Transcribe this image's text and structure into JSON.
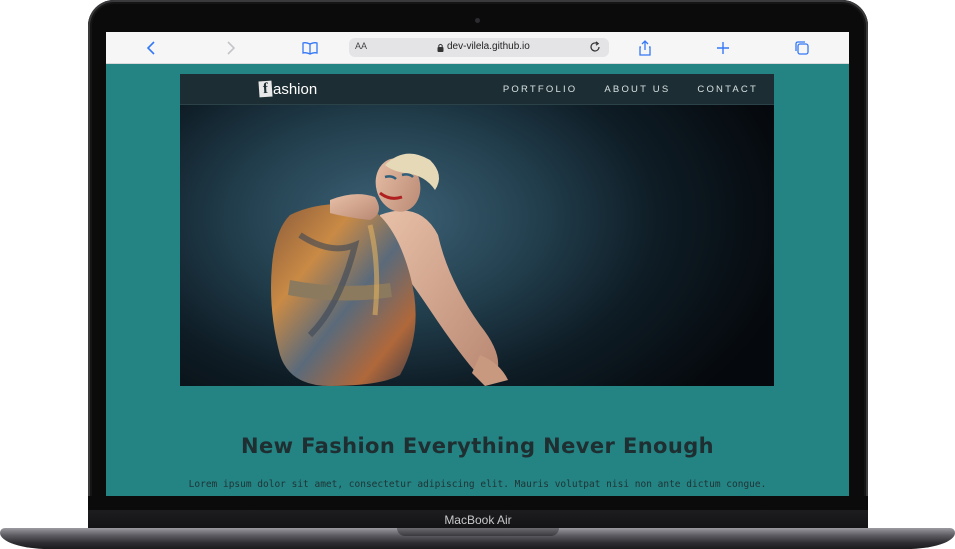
{
  "device": {
    "model_label": "MacBook Air"
  },
  "browser": {
    "url": "dev-vilela.github.io",
    "text_size_label": "AA",
    "icons": [
      "chevron-left-icon",
      "chevron-right-icon",
      "book-icon",
      "lock-icon",
      "reload-icon",
      "share-icon",
      "plus-icon",
      "tabs-icon"
    ]
  },
  "site": {
    "logo_letter": "f",
    "logo_text": "ashion",
    "nav": {
      "items": [
        {
          "label": "PORTFOLIO"
        },
        {
          "label": "ABOUT US"
        },
        {
          "label": "CONTACT"
        }
      ]
    },
    "headline": "New Fashion Everything Never Enough",
    "body_text": "Lorem ipsum dolor sit amet, consectetur adipiscing elit. Mauris volutpat nisi non ante dictum congue."
  },
  "colors": {
    "page_teal": "#248383",
    "nav_bg": "#1c2e33",
    "browser_accent": "#3478f6"
  }
}
